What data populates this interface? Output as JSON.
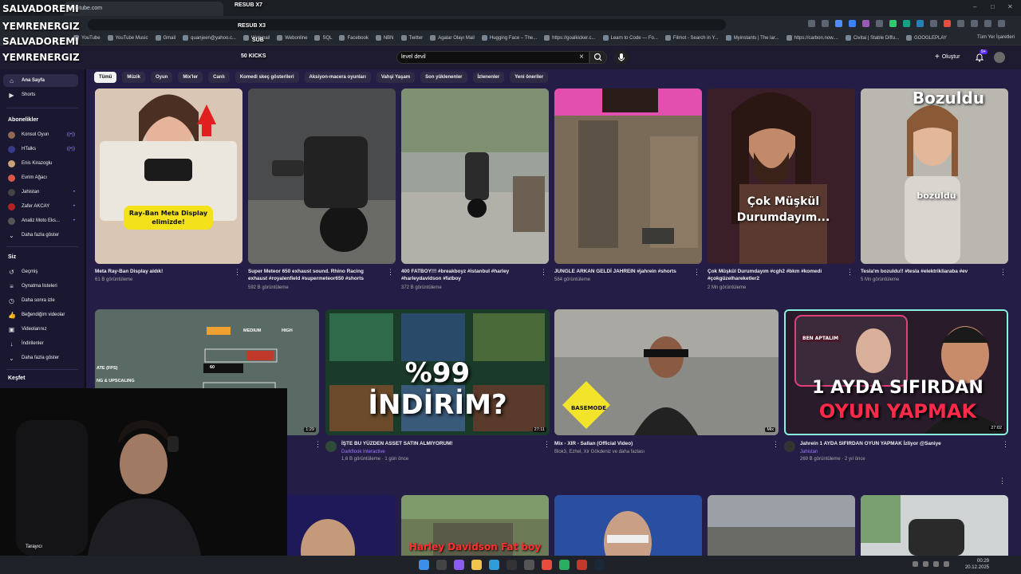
{
  "browser": {
    "tab_title": "youtube.com",
    "window_controls": {
      "minimize": "–",
      "maximize": "□",
      "close": "✕"
    },
    "bookmarks": [
      "YouTube",
      "YouTube Music",
      "Gmail",
      "quanjeen@yahoo.c...",
      "Webmail",
      "Webonline",
      "SQL",
      "Facebook",
      "NBN",
      "Twitter",
      "Agalar Olayı Mail",
      "Hugging Face – The...",
      "https://goalkicker.c...",
      "Learn to Code — Fo...",
      "Filmot - Search in Y...",
      "Myinstants | The lar...",
      "https://carbon.now....",
      "Civitai | Stable Diffu...",
      "GOOGLEPLAY"
    ],
    "bookmarks_right": "Tüm Yer İşaretleri"
  },
  "overlay": {
    "names": [
      "SALVADOREMI",
      "YEMRENERGIZ",
      "SALVADOREMI",
      "YEMRENERGIZ"
    ],
    "right": [
      "RESUB X7",
      "RESUB X3",
      "SUB",
      "50 KICKS"
    ]
  },
  "header": {
    "search_value": "level devil",
    "create_label": "Oluştur",
    "notification_count": "9+"
  },
  "chips": [
    "Tümü",
    "Müzik",
    "Oyun",
    "Mix'ler",
    "Canlı",
    "Komedi skeç gösterileri",
    "Aksiyon-macera oyunları",
    "Vahşi Yaşam",
    "Son yüklenenler",
    "İzlenenler",
    "Yeni öneriler"
  ],
  "sidebar": {
    "top": [
      {
        "label": "Ana Sayfa",
        "icon": "home-icon"
      },
      {
        "label": "Shorts",
        "icon": "shorts-icon"
      }
    ],
    "subs_header": "Abonelikler",
    "subs": [
      {
        "label": "Konsol Oyun",
        "color": "#8d6b55",
        "live": "((•))"
      },
      {
        "label": "HTalks",
        "color": "#3a3a8a",
        "live": "((•))"
      },
      {
        "label": "Enis Kirazoglu",
        "color": "#c9a27a",
        "live": ""
      },
      {
        "label": "Evrim Ağacı",
        "color": "#d9574a",
        "live": ""
      },
      {
        "label": "Jahistan",
        "color": "#444444",
        "live": "•"
      },
      {
        "label": "Zafer AKCAY",
        "color": "#b22222",
        "live": "•"
      },
      {
        "label": "Analiz Moto Eks...",
        "color": "#555555",
        "live": "•"
      }
    ],
    "more": "Daha fazla göster",
    "you_header": "Siz",
    "you": [
      {
        "label": "Geçmiş",
        "icon": "history-icon"
      },
      {
        "label": "Oynatma listeleri",
        "icon": "playlist-icon"
      },
      {
        "label": "Daha sonra izle",
        "icon": "clock-icon"
      },
      {
        "label": "Beğendiğim videolar",
        "icon": "like-icon"
      },
      {
        "label": "Videolarınız",
        "icon": "video-icon"
      },
      {
        "label": "İndirilenler",
        "icon": "download-icon"
      },
      {
        "label": "Daha fazla göster",
        "icon": "chevron-down-icon"
      }
    ],
    "explore_header": "Keşfet",
    "bottom_item": "Tarayıcı"
  },
  "row1": [
    {
      "title": "Meta Ray-Ban Display aldık!",
      "meta": "61 B görüntüleme",
      "thumb_text": "Ray-Ban Meta Display elimizde!",
      "bg": "#c9b7a4"
    },
    {
      "title": "Super Meteor 650 exhaust sound. Rhino Racing exhaust #royalenfield #supermeteor650 #shorts",
      "meta": "592 B görüntüleme",
      "thumb_text": "",
      "bg": "#3c3d3f"
    },
    {
      "title": "400 FATBOY!!! #breakboyz #istanbul #harley #harleydavidson #fatboy",
      "meta": "372 B görüntüleme",
      "thumb_text": "",
      "bg": "#8a8a7e"
    },
    {
      "title": "JUNGLE ARKAN GELDİ JAHREIN #jahrein #shorts",
      "meta": "584 görüntüleme",
      "thumb_text": "",
      "bg": "#6b5a4a"
    },
    {
      "title": "Çok Müşkül Durumdayım #cgh2 #bkm #komedi #çokgüzelhareketler2",
      "meta": "2 Mn görüntüleme",
      "thumb_text": "Çok Müşkül Durumdayım...",
      "bg": "#4a2a33"
    },
    {
      "title": "Tesla'm bozuldu!! #tesla #elektrikliaraba #ev",
      "meta": "5 Mn görüntüleme",
      "thumb_text": "Bozuldu",
      "thumb_text2": "bozuldu",
      "bg": "#a7a39b"
    }
  ],
  "row2": [
    {
      "title": "",
      "channel": "",
      "meta": "",
      "duration": "1:29",
      "bg": "#3b4a45"
    },
    {
      "title": "İŞTE BU YÜZDEN ASSET SATIN ALMIYORUM!",
      "channel": "Darkflook Interactive",
      "meta": "1,6 B görüntüleme · 1 gün önce",
      "duration": "27:11",
      "thumb_text": "%99 İNDİRİM?",
      "bg": "#1d3a2c"
    },
    {
      "title": "Mix - XIR - Sallan (Official Video)",
      "channel": "",
      "meta": "Blok3, Ezhel, Xir Gökdeniz ve daha fazlası",
      "duration": "Mix",
      "thumb_text": "BASEMODE",
      "bg": "#7a7a78"
    },
    {
      "title": "Jahrein 1 AYDA SIFIRDAN OYUN YAPMAK İzliyor @Saniye",
      "channel": "Jahistan",
      "meta": "269 B görüntüleme · 2 yıl önce",
      "duration": "27:02",
      "thumb_text": "1 AYDA SIFIRDAN",
      "thumb_text2": "OYUN YAPMAK",
      "badge_text": "BEN APTALIM",
      "bg": "#2a1b2b"
    }
  ],
  "row2_first_overlay": [
    "MEDIUM",
    "HIGH",
    "ATE (FPS)",
    "60",
    "NG & UPSCALING"
  ],
  "row3": [
    {
      "thumb_text": "",
      "bg": "#2b2a6a"
    },
    {
      "thumb_text": "Harley Davidson Fat boy",
      "bg": "#6d7a56"
    },
    {
      "thumb_text": "",
      "bg": "#2a4fa0"
    },
    {
      "thumb_text": "",
      "bg": "#8c8c8c"
    },
    {
      "thumb_text": "",
      "bg": "#cfd1d2"
    }
  ],
  "taskbar": {
    "time": "00:29",
    "date": "20.12.2025"
  }
}
